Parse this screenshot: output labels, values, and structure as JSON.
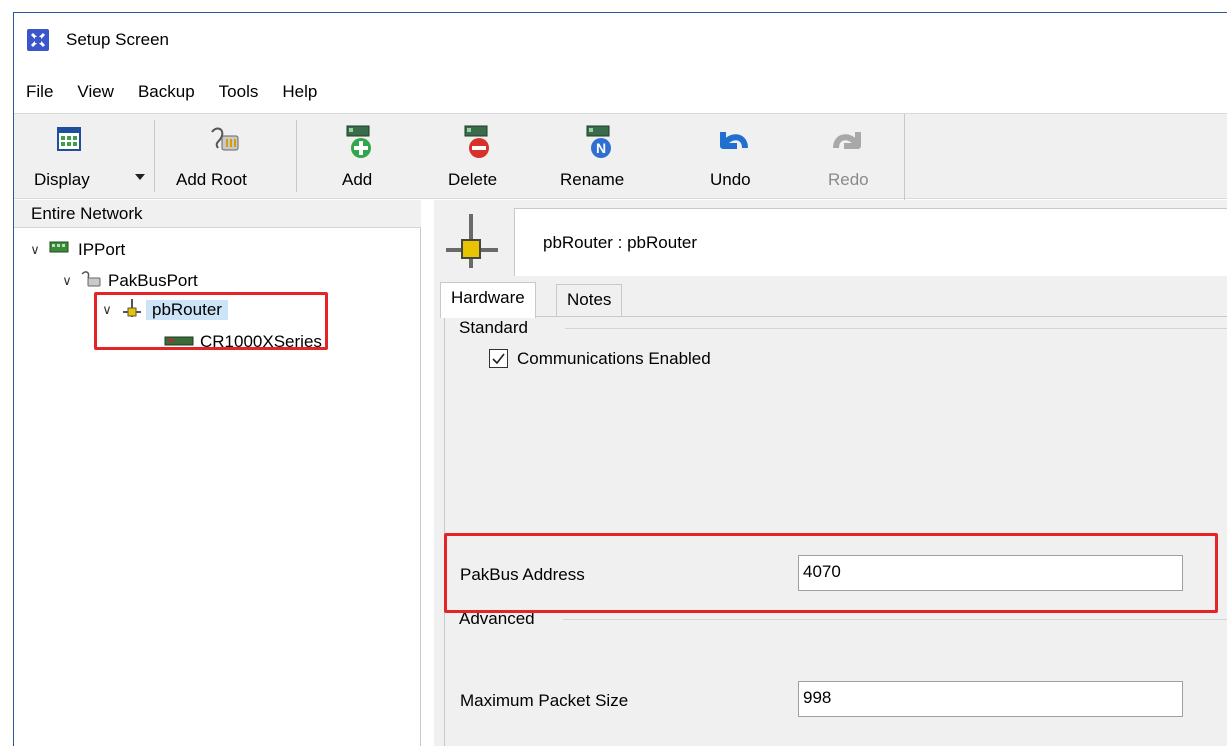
{
  "window": {
    "title": "Setup Screen"
  },
  "menu": [
    "File",
    "View",
    "Backup",
    "Tools",
    "Help"
  ],
  "toolbar": {
    "display": "Display",
    "add_root": "Add Root",
    "add": "Add",
    "delete": "Delete",
    "rename": "Rename",
    "undo": "Undo",
    "redo": "Redo",
    "redo_enabled": false
  },
  "tree": {
    "header": "Entire Network",
    "nodes": [
      {
        "label": "IPPort",
        "level": 0,
        "expanded": true
      },
      {
        "label": "PakBusPort",
        "level": 1,
        "expanded": true
      },
      {
        "label": "pbRouter",
        "level": 2,
        "expanded": true,
        "selected": true
      },
      {
        "label": "CR1000XSeries",
        "level": 3
      }
    ]
  },
  "detail": {
    "title": "pbRouter : pbRouter",
    "tabs": [
      "Hardware",
      "Notes"
    ],
    "active_tab": "Hardware",
    "standard_group": "Standard",
    "comm_enabled_label": "Communications Enabled",
    "comm_enabled": true,
    "pakbus_address_label": "PakBus Address",
    "pakbus_address": "4070",
    "advanced_group": "Advanced",
    "max_packet_label": "Maximum Packet Size",
    "max_packet_size": "998"
  },
  "colors": {
    "highlight": "#e52525",
    "selection": "#cce4f7",
    "panel_bg": "#f0f0f0"
  }
}
